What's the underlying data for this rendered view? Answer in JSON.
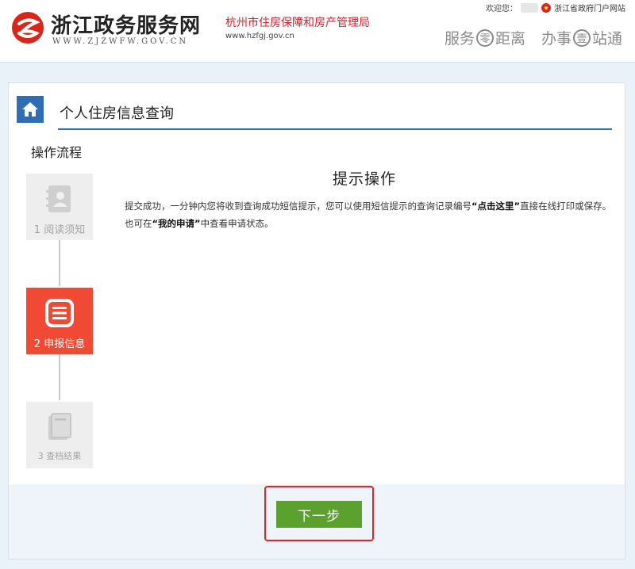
{
  "header": {
    "site_name": "浙江政务服务网",
    "site_domain": "WWW.ZJZWFW.GOV.CN",
    "bureau_name": "杭州市住房保障和房产管理局",
    "bureau_domain": "www.hzfgj.gov.cn",
    "welcome": "欢迎您：",
    "portal_link": "浙江省政府门户网站",
    "slogan": {
      "part1": "服务",
      "circle1": "零",
      "part2": "距离",
      "part3": "办事",
      "circle2": "壹",
      "part4": "站通"
    }
  },
  "main": {
    "page_title": "个人住房信息查询",
    "flow_title": "操作流程",
    "steps": [
      {
        "label": "1 阅读须知",
        "state": "inactive"
      },
      {
        "label": "2 申报信息",
        "state": "active"
      },
      {
        "label": "3 查档结果",
        "state": "inactive"
      }
    ],
    "tip_title": "提示操作",
    "tip": {
      "p1": "提交成功，一分钟内您将收到查询成功短信提示，您可以使用短信提示的查询记录编号",
      "b1": "“点击这里”",
      "p2": "直接在线打印或保存。也可在",
      "b2": "“我的申请”",
      "p3": "中查看申请状态。"
    },
    "next_button": "下一步"
  },
  "colors": {
    "primary_blue": "#2f6db5",
    "active_step": "#f04a34",
    "next_button": "#5aa12e",
    "highlight_border": "#e5202c",
    "bureau_red": "#d0202f"
  }
}
